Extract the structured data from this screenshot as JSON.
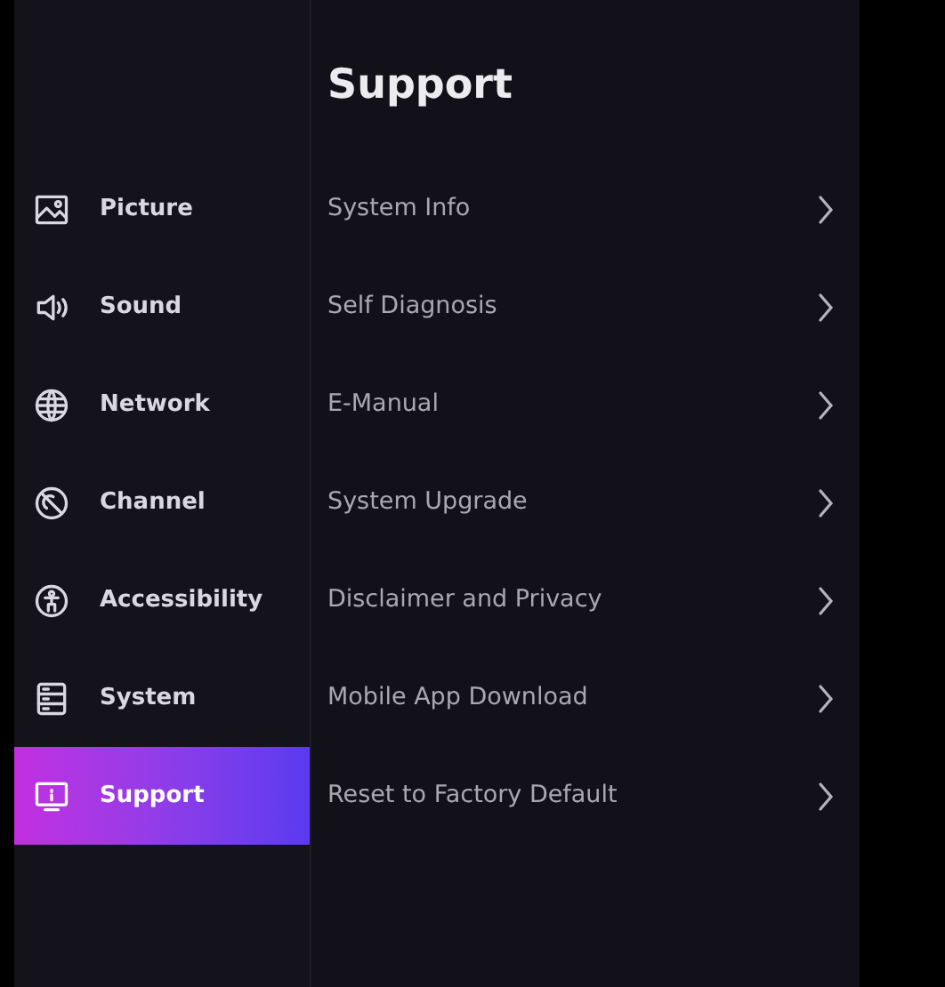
{
  "sidebar": {
    "items": [
      {
        "label": "Picture",
        "selected": false
      },
      {
        "label": "Sound",
        "selected": false
      },
      {
        "label": "Network",
        "selected": false
      },
      {
        "label": "Channel",
        "selected": false
      },
      {
        "label": "Accessibility",
        "selected": false
      },
      {
        "label": "System",
        "selected": false
      },
      {
        "label": "Support",
        "selected": true
      }
    ]
  },
  "panel": {
    "title": "Support",
    "items": [
      {
        "label": "System Info"
      },
      {
        "label": "Self Diagnosis"
      },
      {
        "label": "E-Manual"
      },
      {
        "label": "System Upgrade"
      },
      {
        "label": "Disclaimer and Privacy"
      },
      {
        "label": "Mobile App Download"
      },
      {
        "label": "Reset to Factory Default"
      }
    ]
  }
}
